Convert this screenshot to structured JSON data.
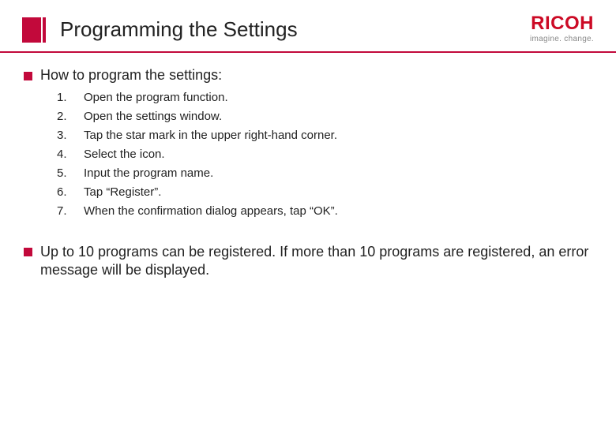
{
  "header": {
    "title": "Programming the Settings",
    "logo": {
      "text": "RICOH",
      "tagline": "imagine. change."
    }
  },
  "intro": "How to program the settings:",
  "steps": [
    {
      "num": "1.",
      "text": "Open the program function."
    },
    {
      "num": "2.",
      "text": "Open the settings window."
    },
    {
      "num": "3.",
      "text": "Tap the star mark in the upper right-hand corner."
    },
    {
      "num": "4.",
      "text": "Select the icon."
    },
    {
      "num": "5.",
      "text": "Input the program name."
    },
    {
      "num": "6.",
      "text": "Tap “Register”."
    },
    {
      "num": "7.",
      "text": "When the confirmation dialog appears, tap “OK”."
    }
  ],
  "note": "Up to 10 programs can be registered. If more than 10 programs are registered, an error message will be displayed."
}
